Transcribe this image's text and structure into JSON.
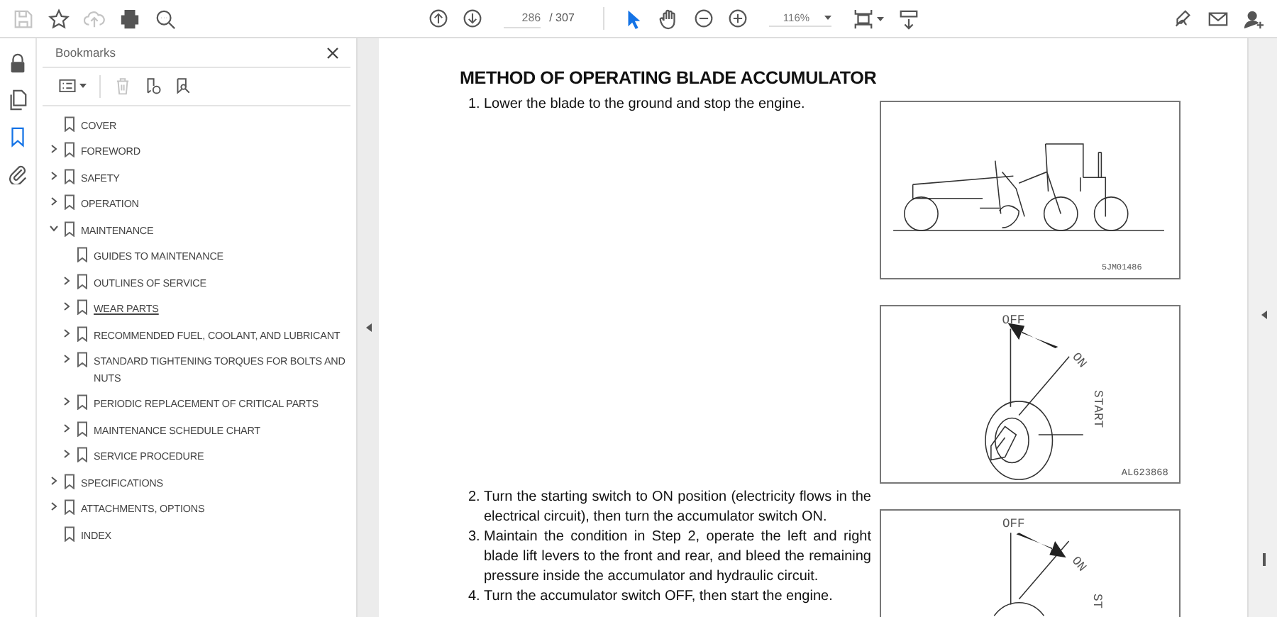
{
  "toolbar": {
    "file_tools": [
      {
        "disabled": true
      },
      {
        "disabled": false
      },
      {
        "disabled": true
      },
      {
        "disabled": false
      },
      {
        "disabled": false
      }
    ],
    "page_number": "286",
    "page_total": "/ 307",
    "tools": [
      {
        "selected": true
      },
      {
        "selected": false
      }
    ],
    "zoom_value": "116%"
  },
  "side_rail": [
    {
      "selected": false
    },
    {
      "selected": false
    },
    {
      "selected": true
    },
    {
      "selected": false
    }
  ],
  "bookmarks_panel": {
    "title": "Bookmarks",
    "tools": [
      {
        "disabled": false
      },
      {
        "disabled": true
      },
      {
        "disabled": false
      },
      {
        "disabled": false
      }
    ],
    "items": [
      {
        "label": "COVER",
        "hovered": false
      },
      {
        "label": "FOREWORD",
        "expanded": false,
        "hovered": false
      },
      {
        "label": "SAFETY",
        "expanded": false,
        "hovered": false
      },
      {
        "label": "OPERATION",
        "expanded": false,
        "hovered": false
      },
      {
        "label": "MAINTENANCE",
        "expanded": true,
        "hovered": false,
        "children": [
          {
            "label": "GUIDES TO MAINTENANCE",
            "hovered": false
          },
          {
            "label": "OUTLINES OF SERVICE",
            "expanded": false,
            "hovered": false
          },
          {
            "label": "WEAR PARTS",
            "expanded": false,
            "hovered": true
          },
          {
            "label": "RECOMMENDED FUEL, COOLANT, AND LUBRICANT",
            "expanded": false,
            "hovered": false
          },
          {
            "label": "STANDARD TIGHTENING TORQUES FOR BOLTS AND NUTS",
            "expanded": false,
            "hovered": false
          },
          {
            "label": "PERIODIC REPLACEMENT OF CRITICAL PARTS",
            "expanded": false,
            "hovered": false
          },
          {
            "label": "MAINTENANCE SCHEDULE CHART",
            "expanded": false,
            "hovered": false
          },
          {
            "label": "SERVICE PROCEDURE",
            "expanded": false,
            "hovered": false
          }
        ]
      },
      {
        "label": "SPECIFICATIONS",
        "expanded": false,
        "hovered": false
      },
      {
        "label": "ATTACHMENTS, OPTIONS",
        "expanded": false,
        "hovered": false
      },
      {
        "label": "INDEX",
        "hovered": false
      }
    ]
  },
  "document": {
    "heading": "METHOD OF OPERATING BLADE ACCUMULATOR",
    "first_steps": [
      {
        "number": "1.",
        "text": "Lower the blade to the ground and stop the engine."
      }
    ],
    "later_steps": [
      {
        "number": "2.",
        "text": "Turn the starting switch to ON position (electricity flows in the electrical circuit), then turn the accumulator switch ON."
      },
      {
        "number": "3.",
        "text": "Maintain the condition in Step 2, operate the left and right blade lift levers to the front and rear, and bleed the remaining pressure inside the accumulator and hydraulic circuit."
      },
      {
        "number": "4.",
        "text": "Turn the accumulator switch OFF, then start the engine."
      }
    ],
    "figures": [
      {
        "code": "5JM01486"
      },
      {
        "off": "OFF",
        "on": "ON",
        "start": "START",
        "code": "AL623868"
      },
      {
        "off": "OFF",
        "on": "ON",
        "start": "ST"
      }
    ]
  }
}
